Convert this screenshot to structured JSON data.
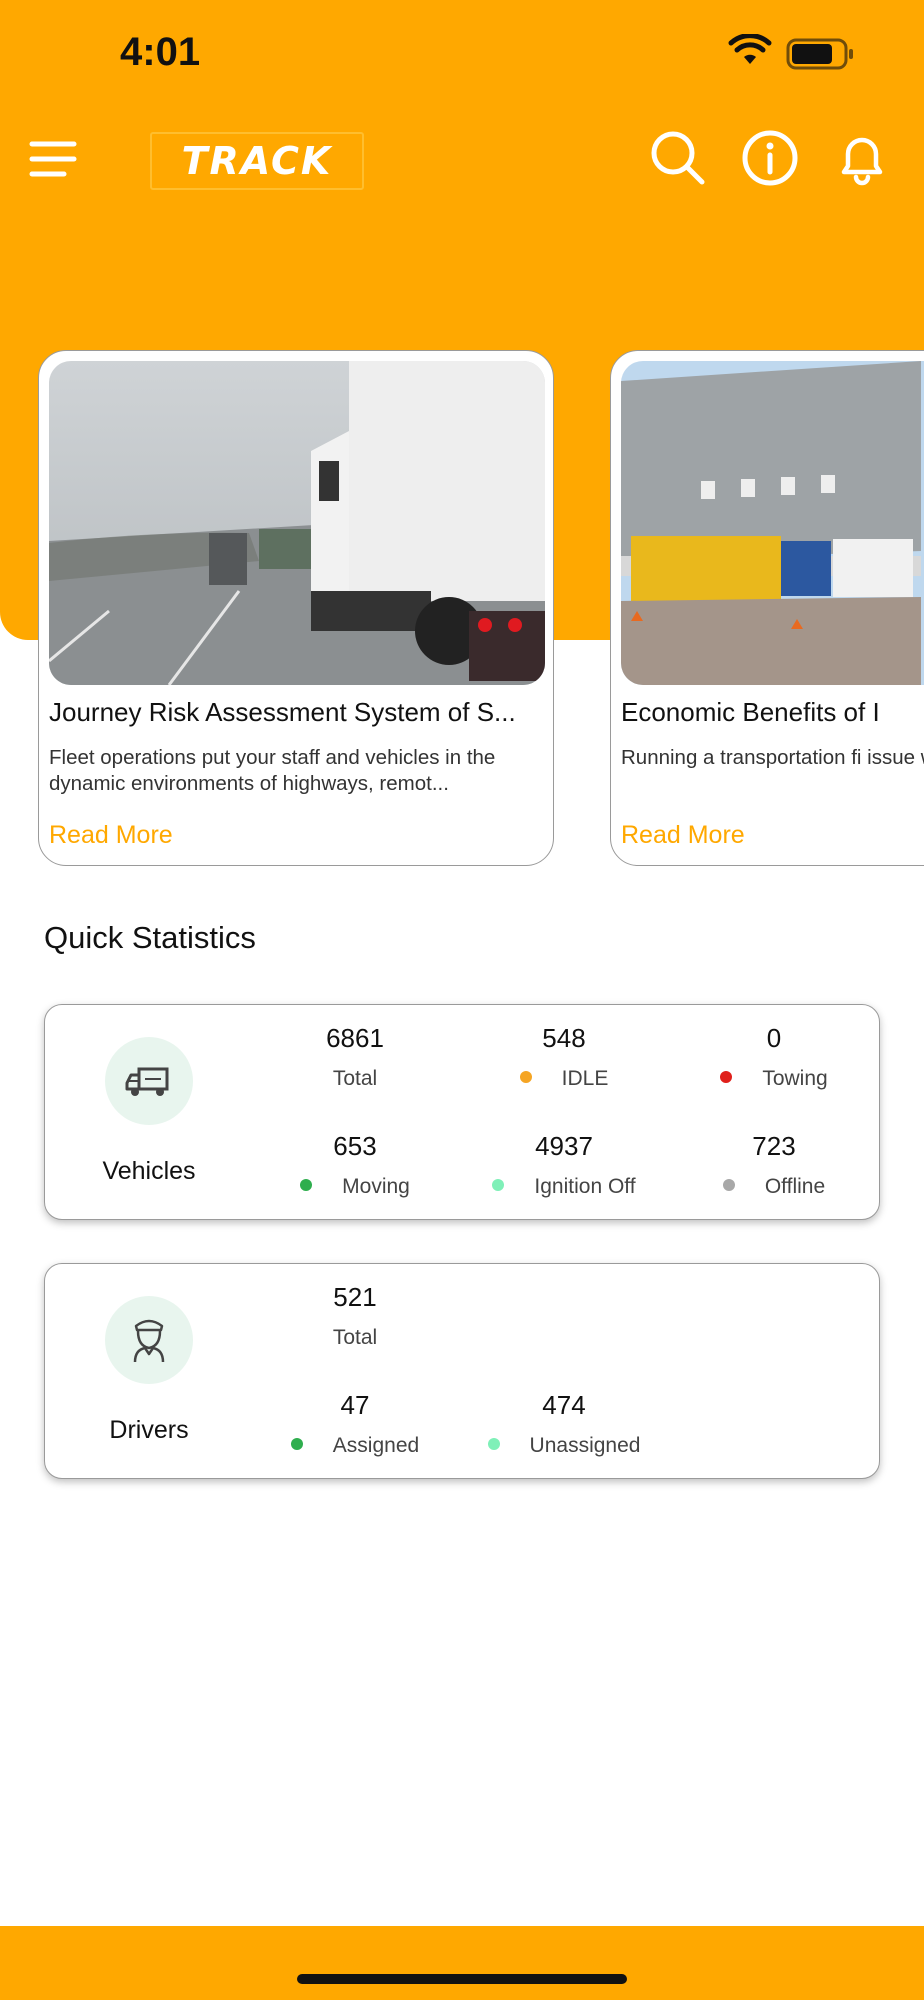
{
  "status_bar": {
    "time": "4:01"
  },
  "header": {
    "logo_text": "TRACK",
    "icons": [
      "menu-icon",
      "search-icon",
      "info-icon",
      "bell-icon"
    ]
  },
  "articles": [
    {
      "title": "Journey Risk Assessment System of S...",
      "description": "Fleet operations put your staff and vehicles in the dynamic environments of highways, remot...",
      "link": "Read More"
    },
    {
      "title": "Economic Benefits of I",
      "description": "Running a transportation fi issue where you have to m",
      "link": "Read More"
    }
  ],
  "quick_stats": {
    "title": "Quick Statistics",
    "vehicles": {
      "label": "Vehicles",
      "icon": "truck-icon",
      "stats": [
        {
          "value": "6861",
          "label": "Total",
          "dot": null
        },
        {
          "value": "548",
          "label": "IDLE",
          "dot": "#F5A524"
        },
        {
          "value": "0",
          "label": "Towing",
          "dot": "#E0201B"
        },
        {
          "value": "653",
          "label": "Moving",
          "dot": "#2FAE4E"
        },
        {
          "value": "4937",
          "label": "Ignition Off",
          "dot": "#7FF0B8"
        },
        {
          "value": "723",
          "label": "Offline",
          "dot": "#A8A8A8"
        }
      ]
    },
    "drivers": {
      "label": "Drivers",
      "icon": "driver-icon",
      "stats": [
        {
          "value": "521",
          "label": "Total",
          "dot": null
        },
        {
          "value": "47",
          "label": "Assigned",
          "dot": "#2FAE4E"
        },
        {
          "value": "474",
          "label": "Unassigned",
          "dot": "#7FF0B8"
        }
      ]
    }
  },
  "colors": {
    "accent": "#FFA800",
    "card_border": "#9a9a9a",
    "icon_bg": "#E8F5EE"
  }
}
